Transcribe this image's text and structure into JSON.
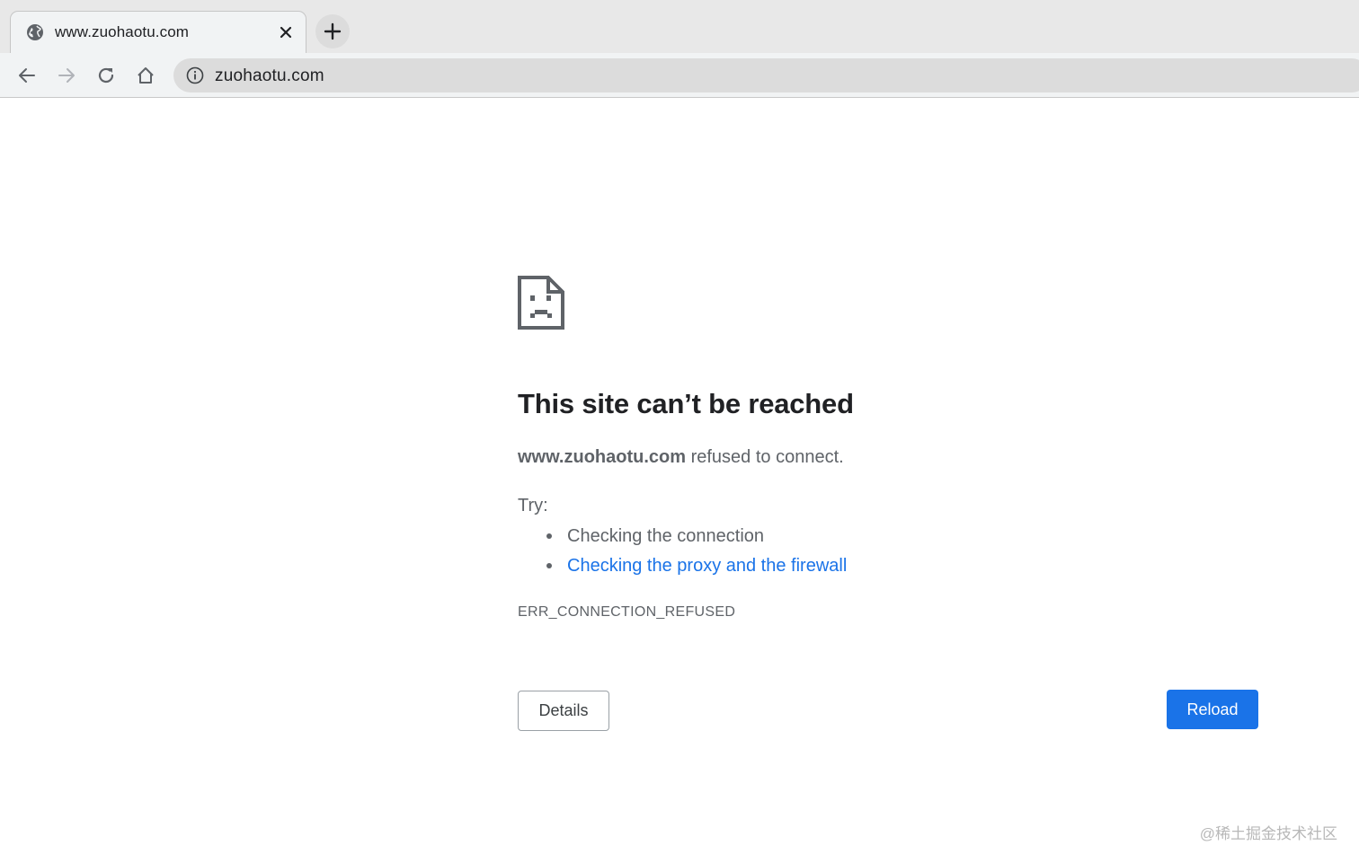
{
  "browser": {
    "tab": {
      "title": "www.zuohaotu.com",
      "favicon": "globe-icon",
      "close_icon": "close-icon"
    },
    "new_tab_icon": "plus-icon",
    "toolbar": {
      "back_icon": "arrow-left-icon",
      "forward_icon": "arrow-right-icon",
      "reload_icon": "reload-icon",
      "home_icon": "home-icon"
    },
    "omnibox": {
      "info_icon": "info-icon",
      "url": "zuohaotu.com"
    }
  },
  "error_page": {
    "icon": "sad-document-icon",
    "title": "This site can’t be reached",
    "host": "www.zuohaotu.com",
    "desc_suffix": " refused to connect.",
    "try_label": "Try:",
    "suggestions": [
      {
        "text": "Checking the connection",
        "is_link": false
      },
      {
        "text": "Checking the proxy and the firewall",
        "is_link": true
      }
    ],
    "error_code": "ERR_CONNECTION_REFUSED",
    "details_label": "Details",
    "reload_label": "Reload",
    "colors": {
      "link": "#1a73e8",
      "primary_button": "#1a73e8",
      "text_secondary": "#5f6368"
    }
  },
  "watermark": "@稀土掘金技术社区"
}
